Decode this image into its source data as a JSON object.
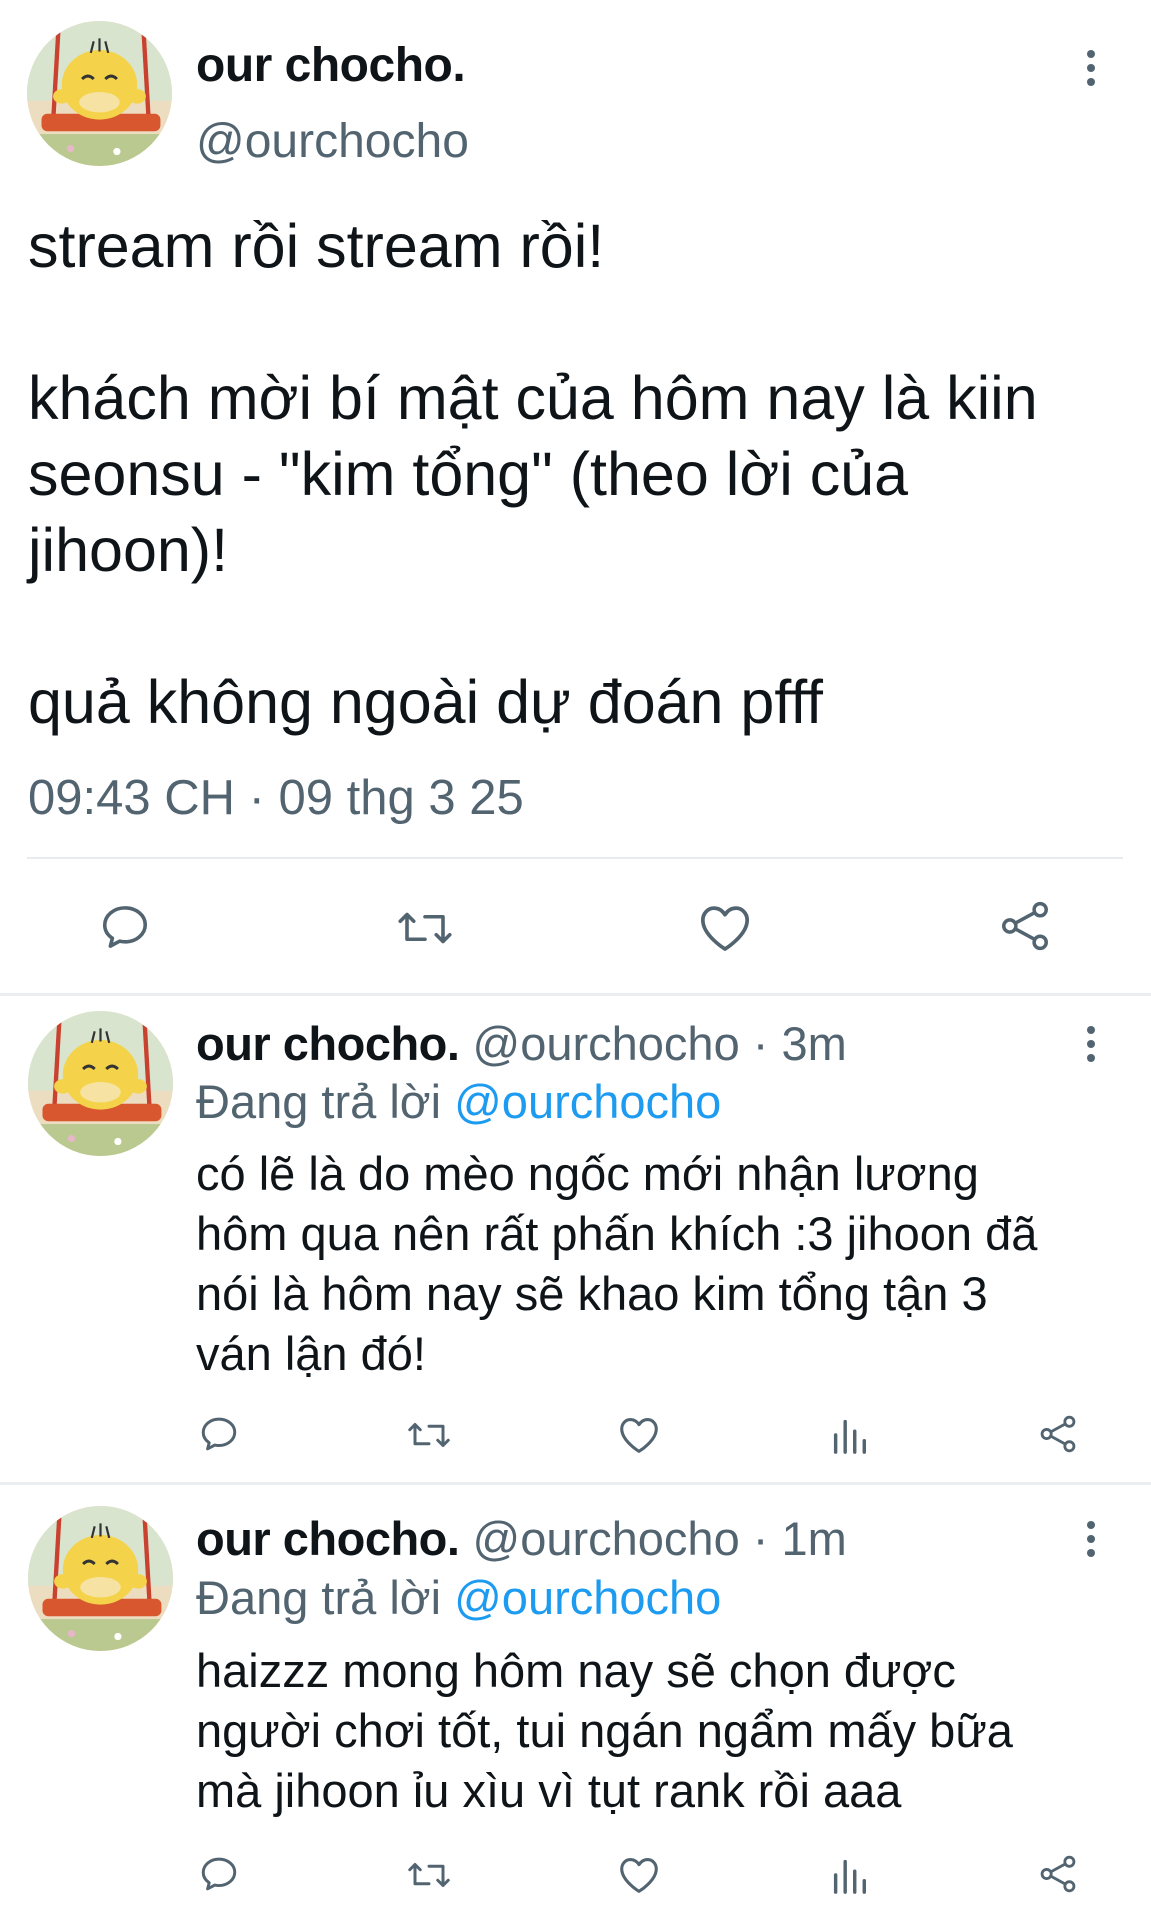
{
  "main_tweet": {
    "display_name": "our chocho.",
    "handle": "@ourchocho",
    "body_lines": [
      "stream rồi stream rồi!",
      "",
      "khách mời bí mật của hôm nay là kiin",
      "seonsu - \"kim tổng\" (theo lời của",
      "jihoon)!",
      "",
      "quả không ngoài dự đoán pfff"
    ],
    "timestamp": "09:43 CH · 09 thg 3 25",
    "actions": [
      "reply-icon",
      "retweet-icon",
      "like-icon",
      "share-icon"
    ]
  },
  "replies": [
    {
      "display_name": "our chocho.",
      "handle": "@ourchocho · 3m",
      "replying_label": "Đang trả lời",
      "replying_to": "@ourchocho",
      "body_lines": [
        "có lẽ là do mèo ngốc mới nhận lương",
        "hôm qua nên rất phấn khích :3 jihoon đã",
        "nói là hôm nay sẽ khao kim tổng tận 3",
        "ván lận đó!"
      ],
      "actions": [
        "reply-icon",
        "retweet-icon",
        "like-icon",
        "views-icon",
        "share-icon"
      ]
    },
    {
      "display_name": "our chocho.",
      "handle": "@ourchocho · 1m",
      "replying_label": "Đang trả lời",
      "replying_to": "@ourchocho",
      "body_lines": [
        "haizzz mong hôm nay sẽ chọn được",
        "người chơi tốt, tui ngán ngẩm mấy bữa",
        "mà jihoon ỉu xìu vì tụt rank rồi aaa"
      ],
      "actions": [
        "reply-icon",
        "retweet-icon",
        "like-icon",
        "views-icon",
        "share-icon"
      ]
    }
  ],
  "colors": {
    "text": "#0f1419",
    "secondary": "#536471",
    "link": "#1d9bf0",
    "divider": "#eaeef1"
  }
}
